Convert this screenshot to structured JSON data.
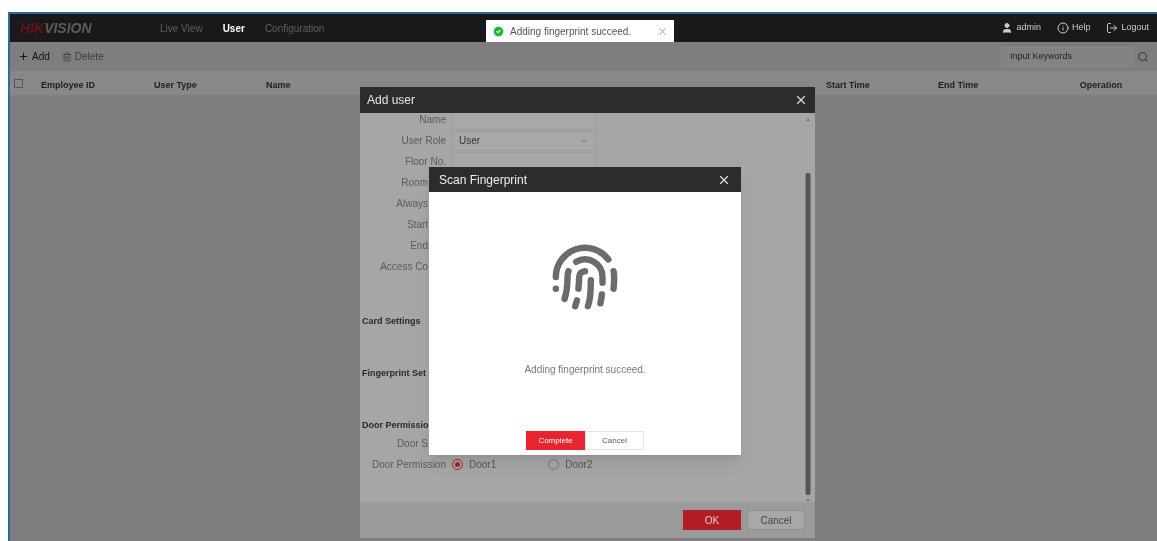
{
  "logo": {
    "accent": "HIK",
    "text": "VISION"
  },
  "nav": [
    {
      "label": "Live View",
      "selected": false
    },
    {
      "label": "User",
      "selected": true
    },
    {
      "label": "Configuration",
      "selected": false
    }
  ],
  "toast": {
    "message": "Adding fingerprint succeed."
  },
  "user_menu": [
    {
      "kind": "user",
      "label": "admin"
    },
    {
      "kind": "help",
      "label": "Help"
    },
    {
      "kind": "logout",
      "label": "Logout"
    }
  ],
  "toolbar": [
    {
      "kind": "add",
      "label": "Add",
      "disabled": false
    },
    {
      "kind": "delete",
      "label": "Delete",
      "disabled": true
    }
  ],
  "search": {
    "placeholder": "Input Keywords"
  },
  "table": {
    "select_all_checked": false,
    "columns_left": [
      "Employee ID",
      "User Type",
      "Name"
    ],
    "columns_right": [
      "Start Time",
      "End Time",
      "Operation"
    ]
  },
  "add_user": {
    "title": "Add user",
    "fields": [
      {
        "kind": "text",
        "label": "Name"
      },
      {
        "kind": "select",
        "label": "User Role",
        "value": "User"
      },
      {
        "kind": "text",
        "label": "Floor No."
      },
      {
        "kind": "label",
        "label": "Room"
      },
      {
        "kind": "label",
        "label": "Always"
      },
      {
        "kind": "label",
        "label": "Start"
      },
      {
        "kind": "label",
        "label": "End"
      },
      {
        "kind": "label",
        "label": "Access Co"
      },
      {
        "kind": "section",
        "label": "Card Settings"
      },
      {
        "kind": "section",
        "label": "Fingerprint Set"
      },
      {
        "kind": "section",
        "label": "Door Permissio"
      },
      {
        "kind": "label",
        "label": "Door S"
      },
      {
        "kind": "radio",
        "label": "Door Permission",
        "options": [
          {
            "label": "Door1",
            "selected": true
          },
          {
            "label": "Door2",
            "selected": false
          }
        ]
      }
    ],
    "buttons": [
      {
        "kind": "primary",
        "label": "OK"
      },
      {
        "kind": "secondary",
        "label": "Cancel"
      }
    ]
  },
  "scan_dialog": {
    "title": "Scan Fingerprint",
    "message": "Adding fingerprint succeed.",
    "buttons": [
      {
        "kind": "primary",
        "label": "Complete"
      },
      {
        "kind": "secondary",
        "label": "Cancel"
      }
    ]
  }
}
